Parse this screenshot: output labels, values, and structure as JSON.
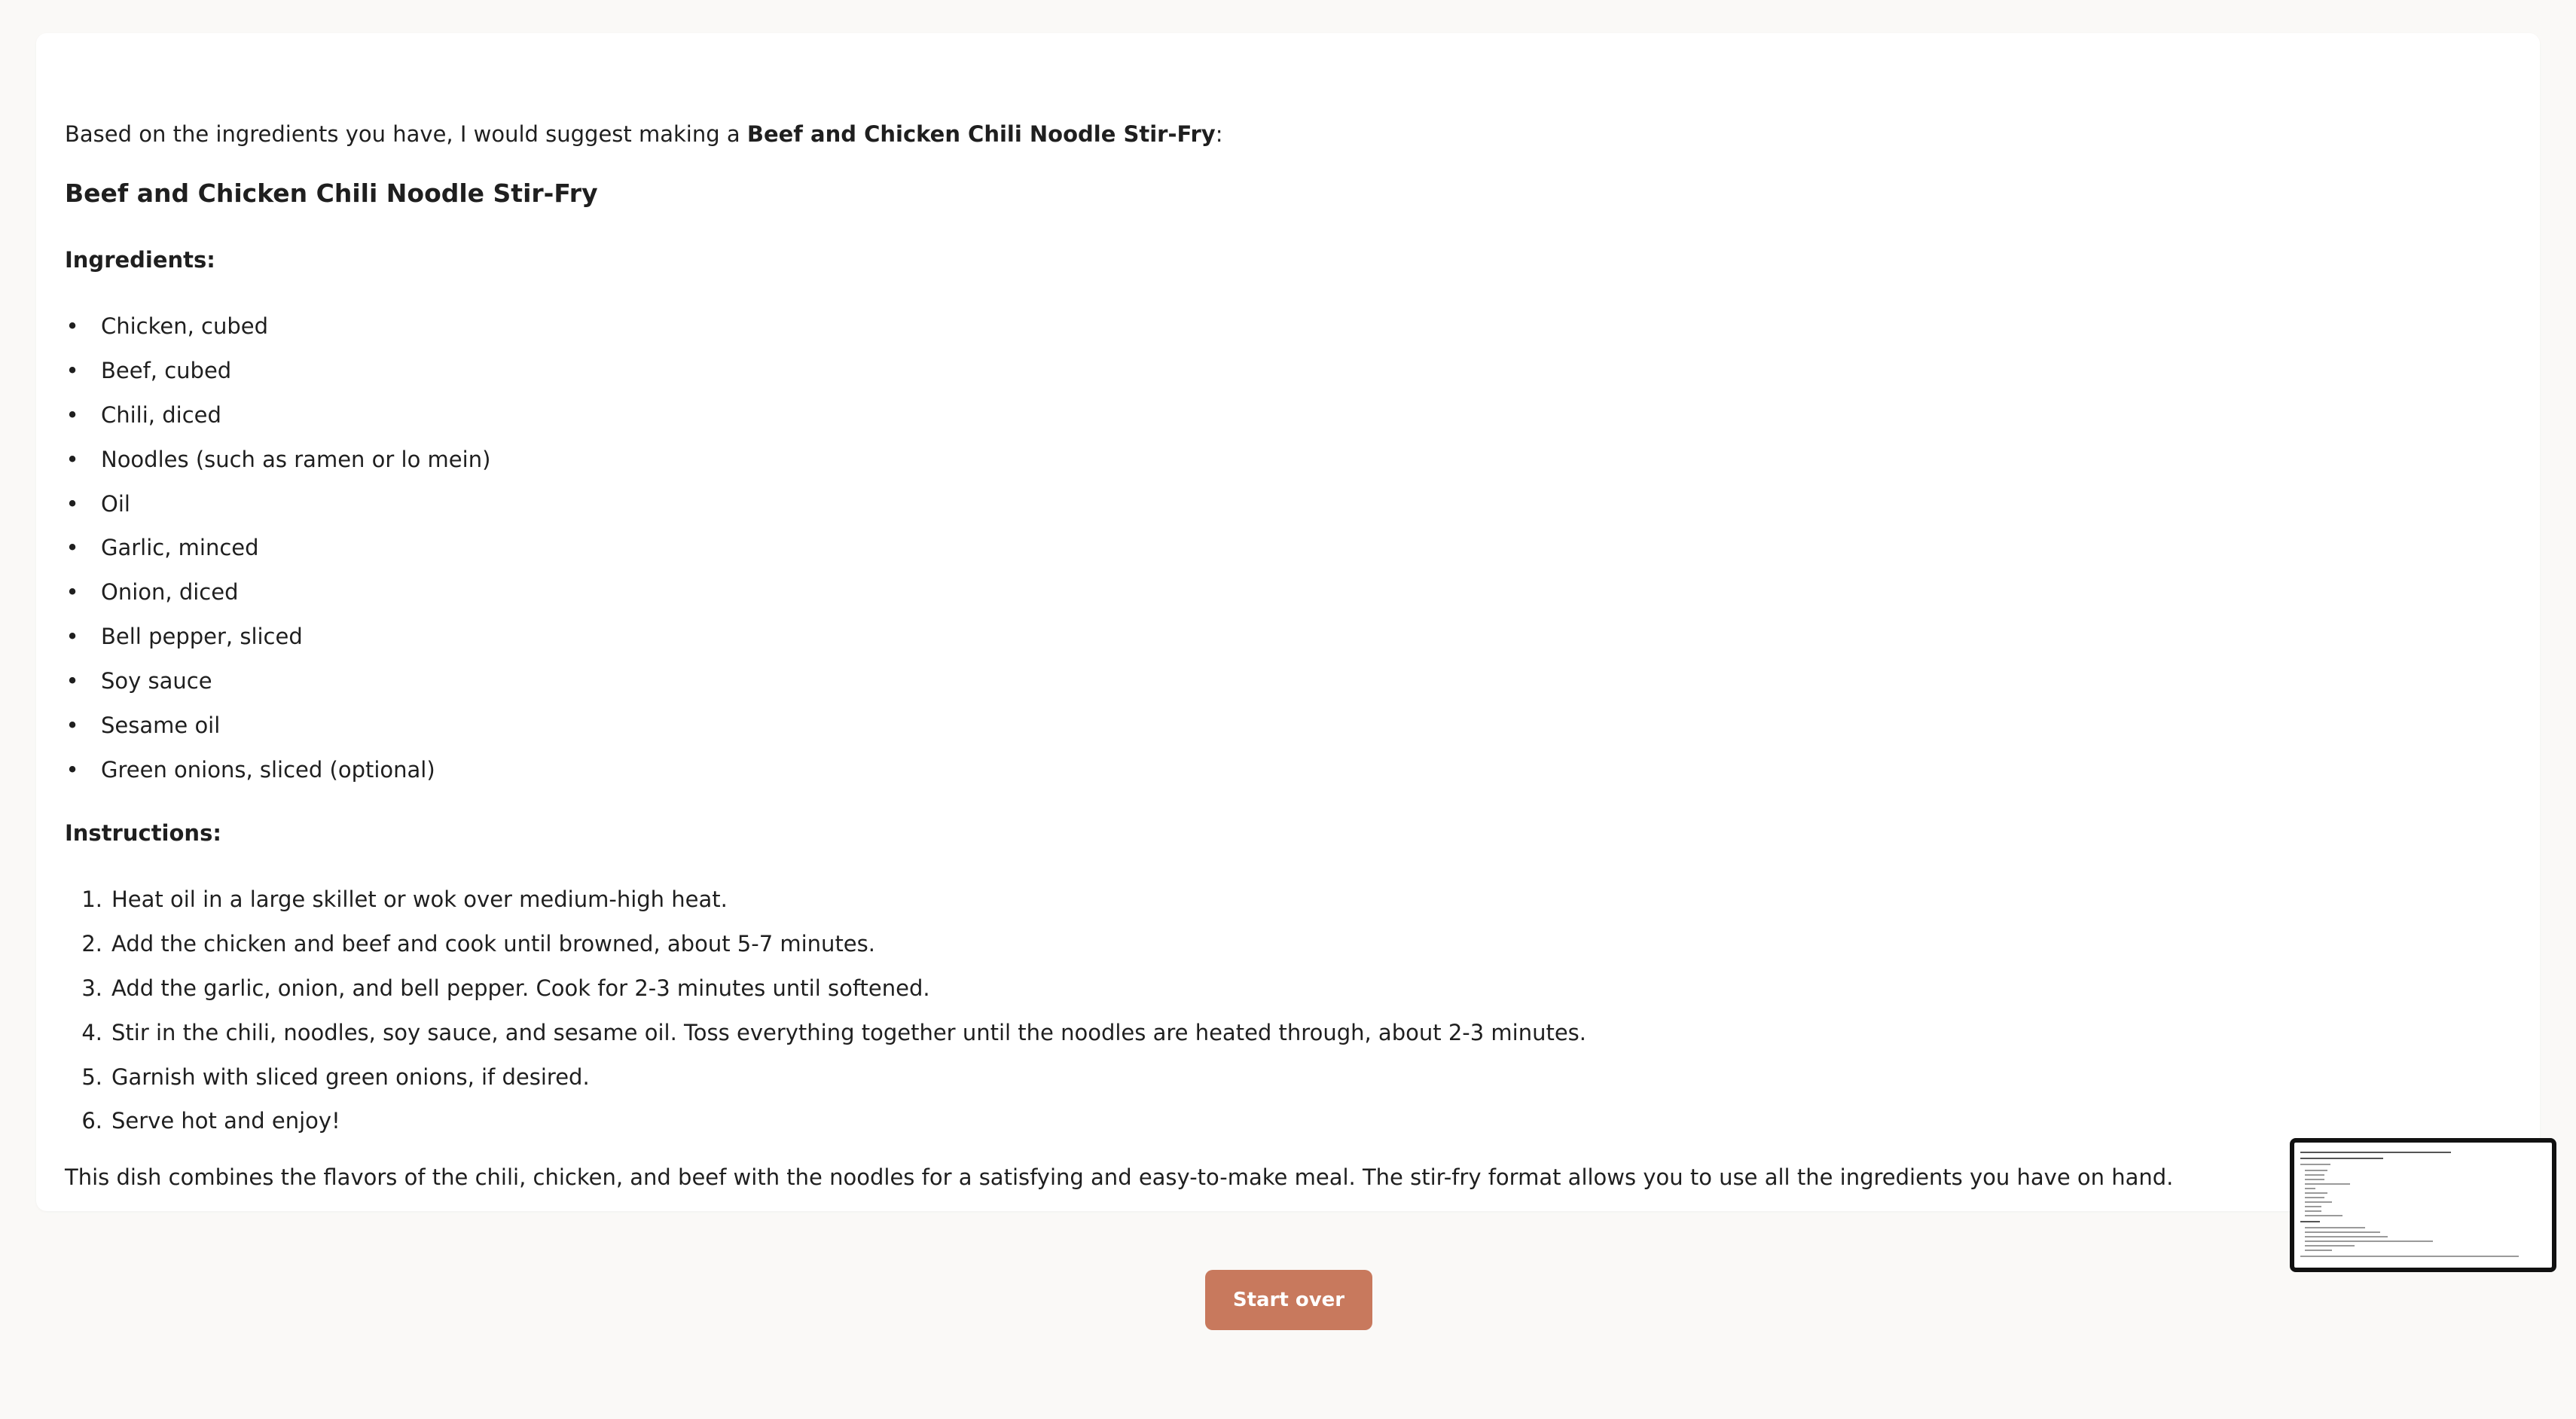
{
  "response": {
    "intro_prefix": "Based on the ingredients you have, I would suggest making a ",
    "intro_bold": "Beef and Chicken Chili Noodle Stir-Fry",
    "intro_suffix": ":",
    "recipe_title": "Beef and Chicken Chili Noodle Stir-Fry",
    "ingredients_label": "Ingredients:",
    "ingredients": [
      "Chicken, cubed",
      "Beef, cubed",
      "Chili, diced",
      "Noodles (such as ramen or lo mein)",
      "Oil",
      "Garlic, minced",
      "Onion, diced",
      "Bell pepper, sliced",
      "Soy sauce",
      "Sesame oil",
      "Green onions, sliced (optional)"
    ],
    "instructions_label": "Instructions:",
    "instructions": [
      "Heat oil in a large skillet or wok over medium-high heat.",
      "Add the chicken and beef and cook until browned, about 5-7 minutes.",
      "Add the garlic, onion, and bell pepper. Cook for 2-3 minutes until softened.",
      "Stir in the chili, noodles, soy sauce, and sesame oil. Toss everything together until the noodles are heated through, about 2-3 minutes.",
      "Garnish with sliced green onions, if desired.",
      "Serve hot and enjoy!"
    ],
    "closing": "This dish combines the flavors of the chili, chicken, and beef with the noodles for a satisfying and easy-to-make meal. The stir-fry format allows you to use all the ingredients you have on hand."
  },
  "actions": {
    "start_over_label": "Start over"
  },
  "colors": {
    "background": "#faf9f7",
    "card": "#ffffff",
    "accent_button": "#c8795d",
    "text": "#1f1f1f"
  }
}
